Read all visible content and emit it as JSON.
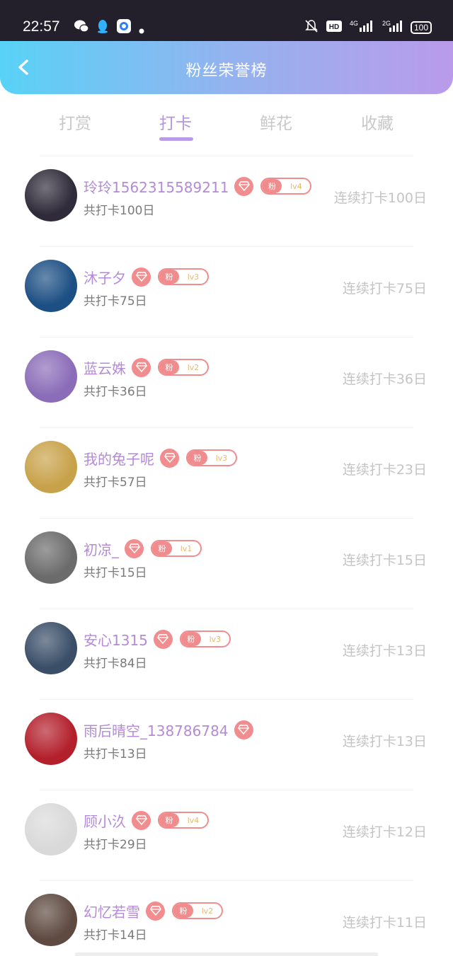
{
  "status": {
    "time": "22:57",
    "battery": "100",
    "network": "4G",
    "network2": "2G"
  },
  "header": {
    "title": "粉丝荣誉榜"
  },
  "tabs": [
    {
      "label": "打赏"
    },
    {
      "label": "打卡"
    },
    {
      "label": "鲜花"
    },
    {
      "label": "收藏"
    }
  ],
  "fans": [
    {
      "name": "玲玲1562315589211",
      "level": "lv4",
      "badge": "粉",
      "total": "共打卡100日",
      "streak": "连续打卡100日",
      "avatar_color": "#2f2b3a"
    },
    {
      "name": "沐子夕",
      "level": "lv3",
      "badge": "粉",
      "total": "共打卡75日",
      "streak": "连续打卡75日",
      "avatar_color": "#1c4f84"
    },
    {
      "name": "蓝云姝",
      "level": "lv2",
      "badge": "粉",
      "total": "共打卡36日",
      "streak": "连续打卡36日",
      "avatar_color": "#8a6cb8"
    },
    {
      "name": "我的兔子呢",
      "level": "lv3",
      "badge": "粉",
      "total": "共打卡57日",
      "streak": "连续打卡23日",
      "avatar_color": "#c8a24a"
    },
    {
      "name": "初凉_",
      "level": "lv1",
      "badge": "粉",
      "total": "共打卡15日",
      "streak": "连续打卡15日",
      "avatar_color": "#6b6b6b"
    },
    {
      "name": "安心1315",
      "level": "lv3",
      "badge": "粉",
      "total": "共打卡84日",
      "streak": "连续打卡13日",
      "avatar_color": "#3a4e68"
    },
    {
      "name": "雨后晴空_138786784",
      "level": "",
      "badge": "",
      "total": "共打卡13日",
      "streak": "连续打卡13日",
      "avatar_color": "#b3202c"
    },
    {
      "name": "顾小汣",
      "level": "lv4",
      "badge": "粉",
      "total": "共打卡29日",
      "streak": "连续打卡12日",
      "avatar_color": "#d9d9d9"
    },
    {
      "name": "幻忆若雪",
      "level": "lv2",
      "badge": "粉",
      "total": "共打卡14日",
      "streak": "连续打卡11日",
      "avatar_color": "#5e4a40"
    }
  ]
}
